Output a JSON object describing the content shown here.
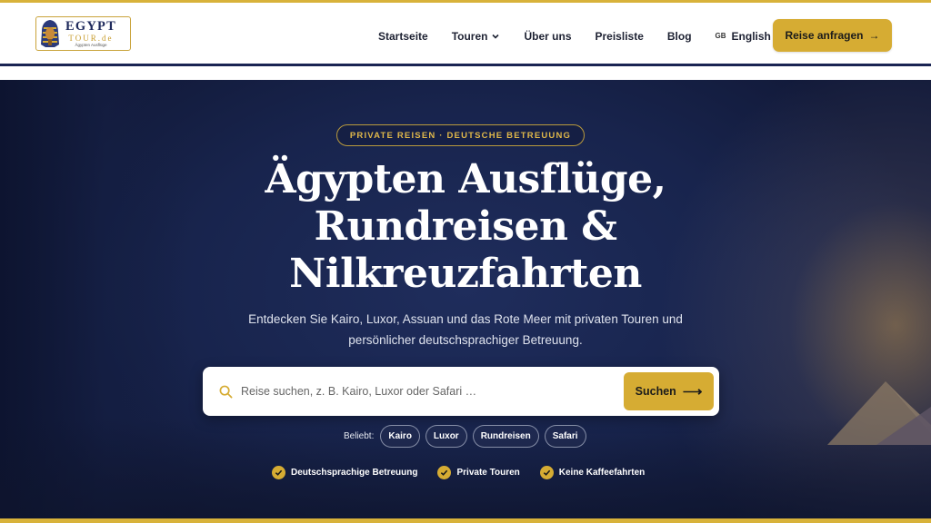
{
  "logo": {
    "line1": "EGYPT",
    "line2": "TOUR.de",
    "line3": "Ägypten Ausflüge"
  },
  "nav": {
    "items": [
      {
        "label": "Startseite"
      },
      {
        "label": "Touren"
      },
      {
        "label": "Über uns"
      },
      {
        "label": "Preisliste"
      },
      {
        "label": "Blog"
      }
    ],
    "lang_flag": "GB",
    "lang_label": "English"
  },
  "header_cta": {
    "label": "Reise anfragen",
    "arrow": "→"
  },
  "hero": {
    "tag": "PRIVATE REISEN · DEUTSCHE BETREUUNG",
    "title_line1": "Ägypten Ausflüge,",
    "title_line2": "Rundreisen &",
    "title_line3": "Nilkreuzfahrten",
    "subtitle_line1": "Entdecken Sie Kairo, Luxor, Assuan und das Rote Meer mit privaten Touren und",
    "subtitle_line2": "persönlicher deutschsprachiger Betreuung."
  },
  "search": {
    "placeholder": "Reise suchen, z. B. Kairo, Luxor oder Safari …",
    "button_label": "Suchen",
    "button_arrow": "⟶"
  },
  "popular": {
    "label": "Beliebt:",
    "chips": [
      "Kairo",
      "Luxor",
      "Rundreisen",
      "Safari"
    ]
  },
  "features": [
    "Deutschsprachige Betreuung",
    "Private Touren",
    "Keine Kaffeefahrten"
  ],
  "colors": {
    "gold": "#d6ac33",
    "navy": "#1a2453",
    "hero_bg": "#18244d"
  }
}
